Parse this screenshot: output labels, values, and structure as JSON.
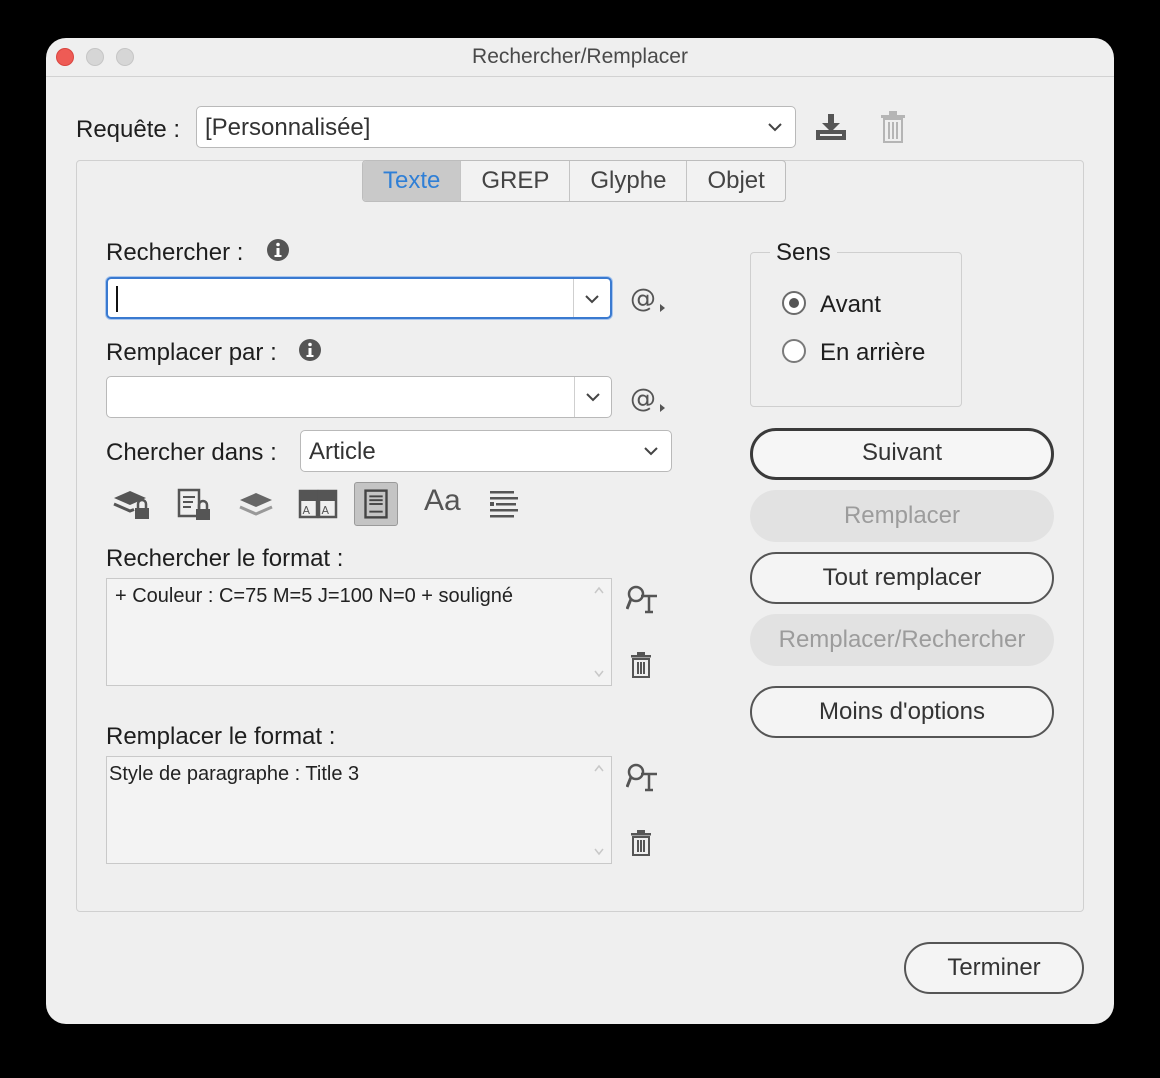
{
  "window": {
    "title": "Rechercher/Remplacer"
  },
  "query": {
    "label": "Requête :",
    "value": "[Personnalisée]"
  },
  "tabs": [
    {
      "label": "Texte",
      "active": true
    },
    {
      "label": "GREP",
      "active": false
    },
    {
      "label": "Glyphe",
      "active": false
    },
    {
      "label": "Objet",
      "active": false
    }
  ],
  "find": {
    "label": "Rechercher :",
    "value": ""
  },
  "replace": {
    "label": "Remplacer par :",
    "value": ""
  },
  "search_in": {
    "label": "Chercher dans :",
    "value": "Article"
  },
  "option_icons": [
    "locked-layers-icon",
    "locked-stories-icon",
    "hidden-layers-icon",
    "master-pages-icon",
    "footnotes-icon",
    "case-sensitive-icon",
    "whole-word-icon"
  ],
  "case_label": "Aa",
  "find_format": {
    "label": "Rechercher le format :",
    "value": "+ Couleur : C=75 M=5 J=100 N=0 + souligné"
  },
  "replace_format": {
    "label": "Remplacer le format :",
    "value": "Style de paragraphe : Title 3"
  },
  "direction": {
    "label": "Sens",
    "options": [
      {
        "label": "Avant",
        "selected": true
      },
      {
        "label": "En arrière",
        "selected": false
      }
    ]
  },
  "buttons": {
    "next": "Suivant",
    "replace": "Remplacer",
    "replace_all": "Tout remplacer",
    "replace_find": "Remplacer/Rechercher",
    "fewer_options": "Moins d'options",
    "done": "Terminer"
  },
  "colors": {
    "active_tab_text": "#2f7fd6",
    "focus_ring": "#3a7ad0",
    "close_button": "#ee5b55"
  }
}
